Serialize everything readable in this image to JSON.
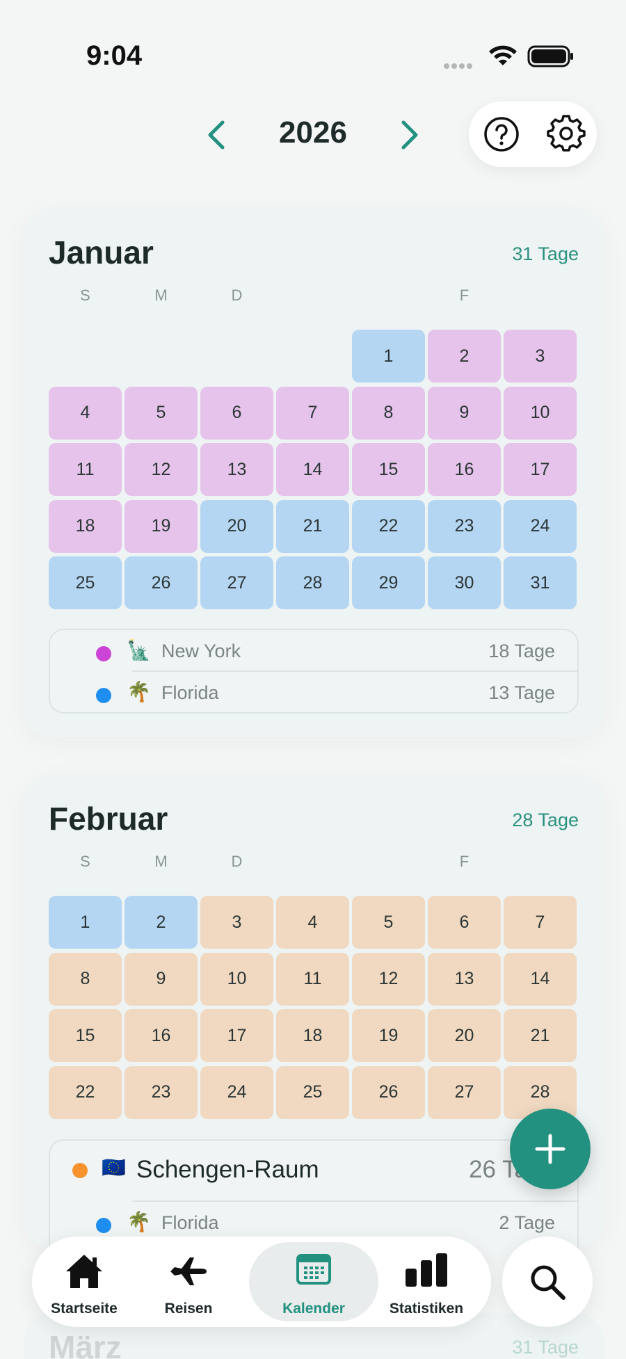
{
  "status_bar": {
    "time": "9:04"
  },
  "header": {
    "year": "2026"
  },
  "months": [
    {
      "name": "Januar",
      "days_label": "31 Tage",
      "weekdays": [
        "S",
        "M",
        "D",
        "F"
      ],
      "days": [
        "1",
        "2",
        "3",
        "4",
        "5",
        "6",
        "7",
        "8",
        "9",
        "10",
        "11",
        "12",
        "13",
        "14",
        "15",
        "16",
        "17",
        "18",
        "19",
        "20",
        "21",
        "22",
        "23",
        "24",
        "25",
        "26",
        "27",
        "28",
        "29",
        "30",
        "31"
      ],
      "legend": [
        {
          "color": "#cc44d6",
          "emoji": "🗽",
          "name": "New York",
          "count": "18 Tage"
        },
        {
          "color": "#1f8ef1",
          "emoji": "🌴",
          "name": "Florida",
          "count": "13 Tage"
        }
      ]
    },
    {
      "name": "Februar",
      "days_label": "28 Tage",
      "weekdays": [
        "S",
        "M",
        "D",
        "F"
      ],
      "days": [
        "1",
        "2",
        "3",
        "4",
        "5",
        "6",
        "7",
        "8",
        "9",
        "10",
        "11",
        "12",
        "13",
        "14",
        "15",
        "16",
        "17",
        "18",
        "19",
        "20",
        "21",
        "22",
        "23",
        "24",
        "25",
        "26",
        "27",
        "28"
      ],
      "legend": [
        {
          "color": "#f7922f",
          "emoji": "🇪🇺",
          "name": "Schengen-Raum",
          "count": "26 Tage"
        },
        {
          "color": "#1f8ef1",
          "emoji": "🌴",
          "name": "Florida",
          "count": "2 Tage"
        }
      ]
    },
    {
      "name": "März",
      "days_label": "31 Tage"
    }
  ],
  "tabs": [
    {
      "label": "Startseite",
      "icon": "home-icon"
    },
    {
      "label": "Reisen",
      "icon": "airplane-icon"
    },
    {
      "label": "Kalender",
      "icon": "calendar-icon"
    },
    {
      "label": "Statistiken",
      "icon": "bar-chart-icon"
    }
  ],
  "colors": {
    "accent": "#23917f",
    "new_york": "#e5c3ea",
    "florida": "#b4d6f2",
    "schengen": "#f0d9c0"
  }
}
